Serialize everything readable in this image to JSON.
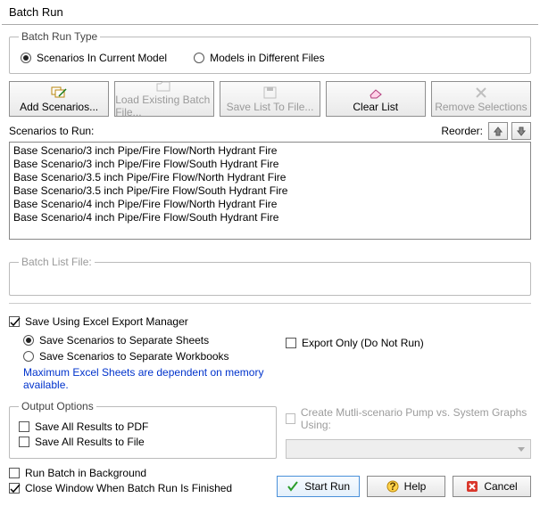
{
  "window": {
    "title": "Batch Run"
  },
  "batchType": {
    "legend": "Batch Run Type",
    "options": [
      {
        "label": "Scenarios In Current Model",
        "checked": true
      },
      {
        "label": "Models in Different Files",
        "checked": false
      }
    ]
  },
  "toolbar": {
    "add": "Add Scenarios...",
    "load": "Load Existing Batch File...",
    "save": "Save List To File...",
    "clear": "Clear List",
    "remove": "Remove Selections"
  },
  "scenarios": {
    "label": "Scenarios to Run:",
    "reorderLabel": "Reorder:",
    "items": [
      "Base Scenario/3 inch Pipe/Fire Flow/North Hydrant Fire",
      "Base Scenario/3 inch Pipe/Fire Flow/South Hydrant Fire",
      "Base Scenario/3.5 inch Pipe/Fire Flow/North Hydrant Fire",
      "Base Scenario/3.5 inch Pipe/Fire Flow/South Hydrant Fire",
      "Base Scenario/4 inch Pipe/Fire Flow/North Hydrant Fire",
      "Base Scenario/4 inch Pipe/Fire Flow/South Hydrant Fire"
    ]
  },
  "batchListFile": {
    "legend": "Batch List File:"
  },
  "saveExcel": {
    "checkLabel": "Save Using Excel Export Manager",
    "sheets": "Save Scenarios to Separate Sheets",
    "workbooks": "Save Scenarios to Separate Workbooks",
    "exportOnly": "Export Only (Do Not Run)",
    "hint": "Maximum Excel Sheets are dependent on memory available."
  },
  "outputOptions": {
    "legend": "Output Options",
    "pdf": "Save All Results to PDF",
    "file": "Save All Results to File"
  },
  "graphs": {
    "label": "Create Mutli-scenario Pump vs. System Graphs Using:"
  },
  "bottom": {
    "bg": "Run Batch in Background",
    "close": "Close Window When Batch Run Is Finished"
  },
  "actions": {
    "start": "Start Run",
    "help": "Help",
    "cancel": "Cancel"
  }
}
